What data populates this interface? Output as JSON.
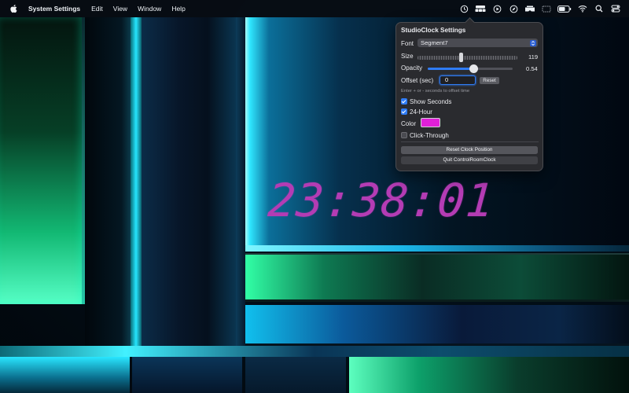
{
  "menubar": {
    "app_name": "System Settings",
    "menus": [
      "Edit",
      "View",
      "Window",
      "Help"
    ],
    "status_icons": [
      "clock-status-icon",
      "control-room-icon",
      "play-icon",
      "compass-icon",
      "vr-headset-icon",
      "display-icon",
      "battery-icon",
      "wifi-icon",
      "search-icon",
      "control-center-icon"
    ]
  },
  "popover": {
    "title": "StudioClock Settings",
    "font_label": "Font",
    "font_value": "Segment7",
    "size_label": "Size",
    "size_value": "119",
    "opacity_label": "Opacity",
    "opacity_value": "0.54",
    "opacity_fraction": 0.54,
    "offset_label": "Offset (sec)",
    "offset_value": "0",
    "reset_label": "Reset",
    "hint": "Enter + or - seconds to offset time",
    "show_seconds_label": "Show Seconds",
    "show_seconds": true,
    "hour24_label": "24-Hour",
    "hour24": true,
    "color_label": "Color",
    "color_value": "#e020d8",
    "click_through_label": "Click-Through",
    "click_through": false,
    "reset_position_label": "Reset Clock Position",
    "quit_label": "Quit ControlRoomClock"
  },
  "clock": {
    "time": "23:38:01",
    "color": "#b43cb4"
  }
}
